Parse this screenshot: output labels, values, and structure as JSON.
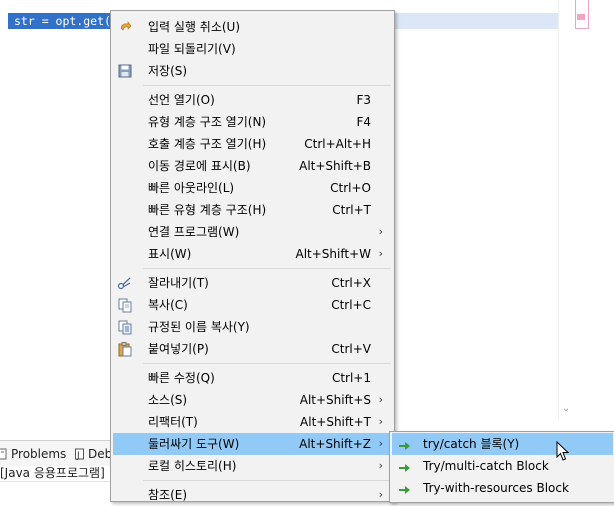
{
  "editor": {
    "code_line": "str = opt.get("
  },
  "context_menu": {
    "items": [
      {
        "label": "입력 실행 취소(U)",
        "shortcut": "",
        "icon": "undo-icon"
      },
      {
        "label": "파일 되돌리기(V)",
        "shortcut": "",
        "icon": ""
      },
      {
        "label": "저장(S)",
        "shortcut": "",
        "icon": "save-icon"
      },
      {
        "label": "선언 열기(O)",
        "shortcut": "F3",
        "icon": ""
      },
      {
        "label": "유형 계층 구조 열기(N)",
        "shortcut": "F4",
        "icon": ""
      },
      {
        "label": "호출 계층 구조 열기(H)",
        "shortcut": "Ctrl+Alt+H",
        "icon": ""
      },
      {
        "label": "이동 경로에 표시(B)",
        "shortcut": "Alt+Shift+B",
        "icon": ""
      },
      {
        "label": "빠른 아웃라인(L)",
        "shortcut": "Ctrl+O",
        "icon": ""
      },
      {
        "label": "빠른 유형 계층 구조(H)",
        "shortcut": "Ctrl+T",
        "icon": ""
      },
      {
        "label": "연결 프로그램(W)",
        "shortcut": "",
        "icon": ""
      },
      {
        "label": "표시(W)",
        "shortcut": "Alt+Shift+W",
        "icon": ""
      },
      {
        "label": "잘라내기(T)",
        "shortcut": "Ctrl+X",
        "icon": "cut-icon"
      },
      {
        "label": "복사(C)",
        "shortcut": "Ctrl+C",
        "icon": "copy-icon"
      },
      {
        "label": "규정된 이름 복사(Y)",
        "shortcut": "",
        "icon": "copy-qualified-icon"
      },
      {
        "label": "붙여넣기(P)",
        "shortcut": "Ctrl+V",
        "icon": "paste-icon"
      },
      {
        "label": "빠른 수정(Q)",
        "shortcut": "Ctrl+1",
        "icon": ""
      },
      {
        "label": "소스(S)",
        "shortcut": "Alt+Shift+S",
        "icon": ""
      },
      {
        "label": "리팩터(T)",
        "shortcut": "Alt+Shift+T",
        "icon": ""
      },
      {
        "label": "둘러싸기 도구(W)",
        "shortcut": "Alt+Shift+Z",
        "icon": ""
      },
      {
        "label": "로컬 히스토리(H)",
        "shortcut": "",
        "icon": ""
      },
      {
        "label": "참조(E)",
        "shortcut": "",
        "icon": ""
      }
    ]
  },
  "submenu": {
    "items": [
      {
        "label": "try/catch 블록(Y)",
        "icon": "surround-icon"
      },
      {
        "label": "Try/multi-catch Block",
        "icon": "surround-icon"
      },
      {
        "label": "Try-with-resources Block",
        "icon": "surround-icon"
      }
    ]
  },
  "bottom_panel": {
    "tabs": [
      {
        "label": "Problems",
        "icon": "problems-icon"
      },
      {
        "label": "Deb",
        "icon": "javadoc-icon"
      }
    ],
    "console_label": "[Java 응용프로그램]"
  },
  "colors": {
    "selection": "#3271c8",
    "highlight": "#91c9f7",
    "menu_bg": "#f2f2f2"
  }
}
